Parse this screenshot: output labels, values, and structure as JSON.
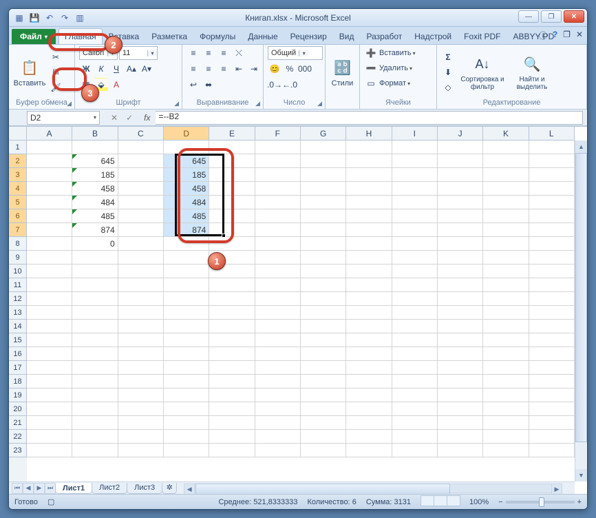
{
  "title": "Книгап.xlsx - Microsoft Excel",
  "qat": {
    "save": "💾",
    "undo": "↶",
    "redo": "↷",
    "custom": "▥"
  },
  "tabs": {
    "file": "Файл",
    "items": [
      "Главная",
      "Вставка",
      "Разметка",
      "Формулы",
      "Данные",
      "Рецензир",
      "Вид",
      "Разработ",
      "Надстрой",
      "Foxit PDF",
      "ABBYY PD"
    ],
    "active": 0
  },
  "ribbon": {
    "clipboard": {
      "label": "Буфер обмена",
      "paste": "Вставить"
    },
    "font": {
      "label": "Шрифт",
      "name": "Calibri",
      "size": "11"
    },
    "alignment": {
      "label": "Выравнивание"
    },
    "number": {
      "label": "Число",
      "format": "Общий"
    },
    "styles": {
      "label": "Стили",
      "btn": "Стили"
    },
    "cells": {
      "label": "Ячейки",
      "insert": "Вставить",
      "delete": "Удалить",
      "format": "Формат"
    },
    "editing": {
      "label": "Редактирование",
      "sort": "Сортировка и фильтр",
      "find": "Найти и выделить"
    }
  },
  "formula_bar": {
    "name": "D2",
    "value": "=--B2"
  },
  "columns": [
    "A",
    "B",
    "C",
    "D",
    "E",
    "F",
    "G",
    "H",
    "I",
    "J",
    "K",
    "L"
  ],
  "selected_cols": [
    "D"
  ],
  "rows": 23,
  "selected_rows": [
    2,
    3,
    4,
    5,
    6,
    7
  ],
  "data_b": {
    "2": "645",
    "3": "185",
    "4": "458",
    "5": "484",
    "6": "485",
    "7": "874",
    "8": "0"
  },
  "data_d": {
    "2": "645",
    "3": "185",
    "4": "458",
    "5": "484",
    "6": "485",
    "7": "874"
  },
  "sheets": {
    "items": [
      "Лист1",
      "Лист2",
      "Лист3"
    ],
    "active": 0
  },
  "status": {
    "ready": "Готово",
    "avg_lbl": "Среднее:",
    "avg": "521,8333333",
    "count_lbl": "Количество:",
    "count": "6",
    "sum_lbl": "Сумма:",
    "sum": "3131",
    "zoom": "100%"
  },
  "callouts": {
    "1": "1",
    "2": "2",
    "3": "3"
  }
}
